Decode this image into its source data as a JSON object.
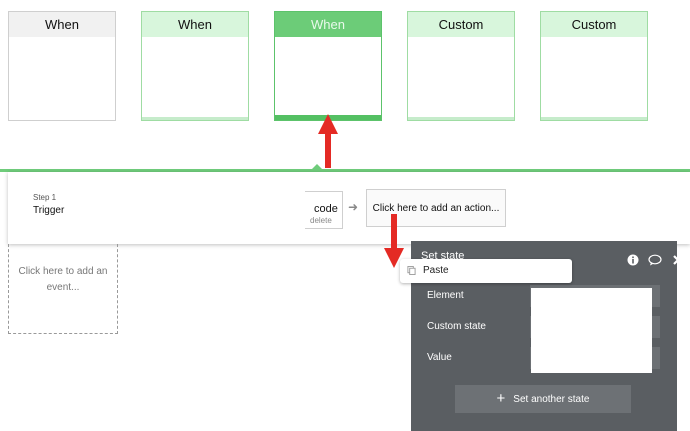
{
  "event_cards": [
    {
      "label": "When",
      "style": "gray"
    },
    {
      "label": "When",
      "style": "green"
    },
    {
      "label": "When",
      "style": "selected"
    },
    {
      "label": "Custom",
      "style": "green"
    },
    {
      "label": "Custom",
      "style": "green"
    }
  ],
  "workflow": {
    "step_label": "Step 1",
    "step_title": "Trigger",
    "code_label": "code",
    "delete_label": "delete",
    "add_action_label": "Click here to add an action...",
    "add_event_label_line1": "Click here to add an",
    "add_event_label_line2": "event..."
  },
  "context_menu": {
    "paste_label": "Paste"
  },
  "panel": {
    "title": "Set state",
    "fields": [
      {
        "label": "Element"
      },
      {
        "label": "Custom state"
      },
      {
        "label": "Value"
      }
    ],
    "add_button_label": "Set another state"
  },
  "colors": {
    "accent_green": "#6fcc7b",
    "annotation_red": "#e42a24",
    "panel_bg": "#5a5e62"
  }
}
